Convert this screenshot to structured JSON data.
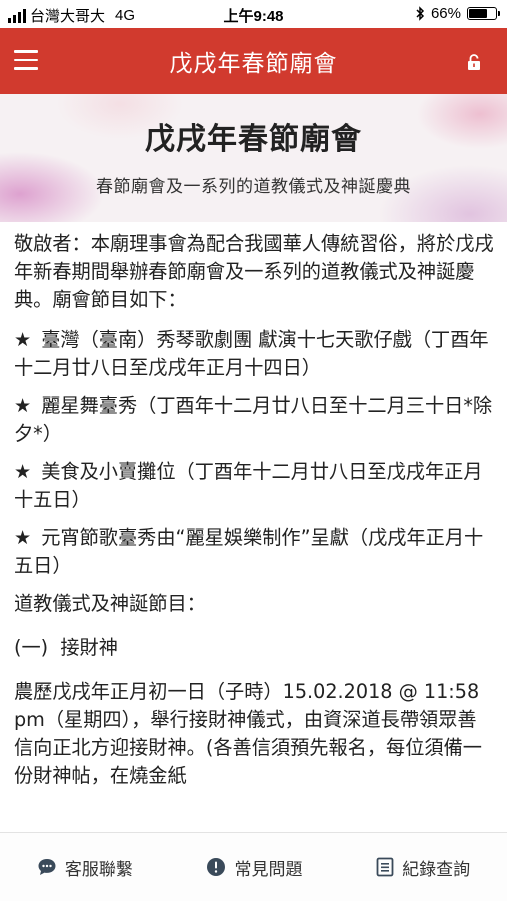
{
  "status_bar": {
    "carrier": "台灣大哥大",
    "network": "4G",
    "time": "上午9:48",
    "battery": "66%"
  },
  "header": {
    "title": "戊戌年春節廟會"
  },
  "banner": {
    "title": "戊戌年春節廟會",
    "subtitle": "春節廟會及一系列的道教儀式及神誕慶典"
  },
  "content": {
    "intro": "敬啟者：本廟理事會為配合我國華人傳統習俗，將於戊戌年新春期間舉辦春節廟會及一系列的道教儀式及神誕慶典。廟會節目如下：",
    "items": [
      "臺灣（臺南）秀琴歌劇團 獻演十七天歌仔戲（丁酉年十二月廿八日至戊戌年正月十四日）",
      "麗星舞臺秀（丁酉年十二月廿八日至十二月三十日*除夕*）",
      "美食及小賣攤位（丁酉年十二月廿八日至戊戌年正月十五日）",
      "元宵節歌臺秀由“麗星娛樂制作”呈獻（戊戌年正月十五日）"
    ],
    "section_title": "道教儀式及神誕節目：",
    "sub_title": "(一)  接財神",
    "body": "農歷戊戌年正月初一日（子時）15.02.2018 @ 11:58 pm（星期四），舉行接財神儀式，由資深道長帶領眾善信向正北方迎接財神。(各善信須預先報名，每位須備一份財神帖，在燒金紙"
  },
  "bottom_nav": {
    "customer_service": "客服聯繫",
    "faq": "常見問題",
    "records": "紀錄查詢"
  },
  "icons": {
    "menu": "hamburger-menu-icon",
    "lock": "lock-icon",
    "chat": "chat-bubble-icon",
    "faq": "exclamation-circle-icon",
    "records": "list-document-icon"
  },
  "colors": {
    "header_bg": "#d13a2e",
    "text": "#222222"
  }
}
